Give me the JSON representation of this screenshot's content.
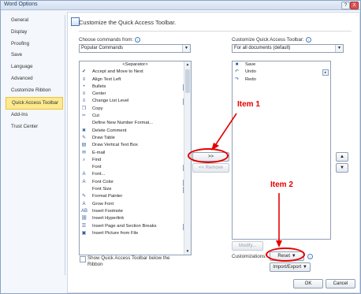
{
  "window": {
    "title": "Word Options",
    "help_label": "?",
    "close_label": "X"
  },
  "nav": {
    "items": [
      {
        "label": "General"
      },
      {
        "label": "Display"
      },
      {
        "label": "Proofing"
      },
      {
        "label": "Save"
      },
      {
        "label": "Language"
      },
      {
        "label": "Advanced"
      },
      {
        "label": "Customize Ribbon"
      },
      {
        "label": "Quick Access Toolbar",
        "active": true
      },
      {
        "label": "Add-Ins"
      },
      {
        "label": "Trust Center"
      }
    ]
  },
  "content": {
    "heading": "Customize the Quick Access Toolbar.",
    "choose_label": "Choose commands from:",
    "choose_value": "Popular Commands",
    "customize_label": "Customize Quick Access Toolbar:",
    "customize_value": "For all documents (default)",
    "commands": [
      {
        "label": "<Separator>",
        "icon": ""
      },
      {
        "label": "Accept and Move to Next",
        "icon": "✔"
      },
      {
        "label": "Align Text Left",
        "icon": "≡"
      },
      {
        "label": "Bullets",
        "icon": "•",
        "sub": true
      },
      {
        "label": "Center",
        "icon": "≡"
      },
      {
        "label": "Change List Level",
        "icon": "≡",
        "sub": true
      },
      {
        "label": "Copy",
        "icon": "❐"
      },
      {
        "label": "Cut",
        "icon": "✂"
      },
      {
        "label": "Define New Number Format...",
        "icon": ""
      },
      {
        "label": "Delete Comment",
        "icon": "✖"
      },
      {
        "label": "Draw Table",
        "icon": "✎"
      },
      {
        "label": "Draw Vertical Text Box",
        "icon": "▤"
      },
      {
        "label": "E-mail",
        "icon": "✉"
      },
      {
        "label": "Find",
        "icon": "⌕"
      },
      {
        "label": "Font",
        "icon": "",
        "sub": true
      },
      {
        "label": "Font...",
        "icon": "A"
      },
      {
        "label": "Font Color",
        "icon": "A",
        "sub": true
      },
      {
        "label": "Font Size",
        "icon": "",
        "sub": true
      },
      {
        "label": "Format Painter",
        "icon": "✎"
      },
      {
        "label": "Grow Font",
        "icon": "A"
      },
      {
        "label": "Insert Footnote",
        "icon": "AB"
      },
      {
        "label": "Insert Hyperlink",
        "icon": "⛓"
      },
      {
        "label": "Insert Page and Section Breaks",
        "icon": "☰",
        "sub": true
      },
      {
        "label": "Insert Picture from File",
        "icon": "▣"
      }
    ],
    "toolbar_items": [
      {
        "label": "Save",
        "icon": "■"
      },
      {
        "label": "Undo",
        "icon": "↶",
        "sub": true
      },
      {
        "label": "Redo",
        "icon": "↷"
      }
    ],
    "add_button": ">>",
    "remove_button": "<< Remove",
    "modify_button": "Modify...",
    "move_up": "▲",
    "move_down": "▼",
    "show_below_label": "Show Quick Access Toolbar below the Ribbon",
    "customizations_label": "Customizations:",
    "reset_button": "Reset",
    "import_export_button": "Import/Export",
    "ok_button": "OK",
    "cancel_button": "Cancel"
  },
  "annotations": {
    "item1": "Item 1",
    "item2": "Item 2"
  },
  "colors": {
    "annotation": "#e60000",
    "active_nav": "#fde98f"
  }
}
